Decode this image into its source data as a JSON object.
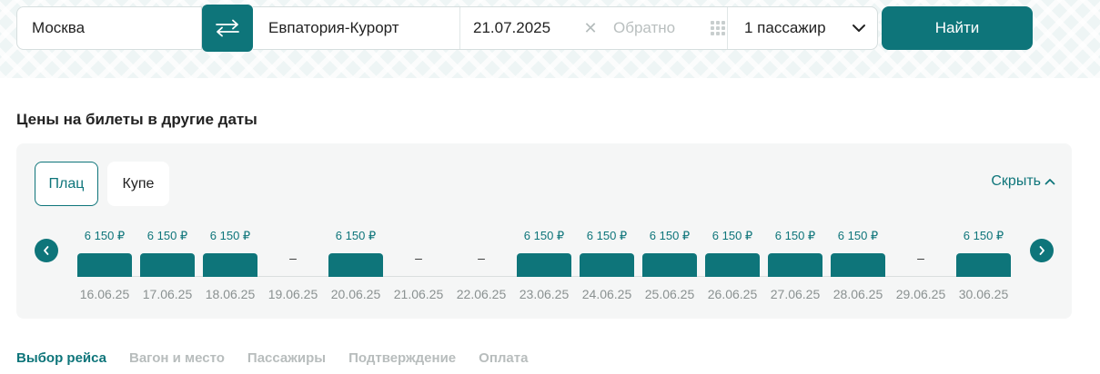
{
  "search": {
    "from": "Москва",
    "to": "Евпатория-Курорт",
    "date": "21.07.2025",
    "return_placeholder": "Обратно",
    "passengers": "1 пассажир",
    "submit_label": "Найти"
  },
  "prices": {
    "title": "Цены на билеты в другие даты",
    "tabs": [
      {
        "label": "Плац",
        "active": true
      },
      {
        "label": "Купе",
        "active": false
      }
    ],
    "hide_label": "Скрыть",
    "dash": "–",
    "days": [
      {
        "date": "16.06.25",
        "price": "6 150 ₽",
        "available": true
      },
      {
        "date": "17.06.25",
        "price": "6 150 ₽",
        "available": true
      },
      {
        "date": "18.06.25",
        "price": "6 150 ₽",
        "available": true
      },
      {
        "date": "19.06.25",
        "price": "",
        "available": false
      },
      {
        "date": "20.06.25",
        "price": "6 150 ₽",
        "available": true
      },
      {
        "date": "21.06.25",
        "price": "",
        "available": false
      },
      {
        "date": "22.06.25",
        "price": "",
        "available": false
      },
      {
        "date": "23.06.25",
        "price": "6 150 ₽",
        "available": true
      },
      {
        "date": "24.06.25",
        "price": "6 150 ₽",
        "available": true
      },
      {
        "date": "25.06.25",
        "price": "6 150 ₽",
        "available": true
      },
      {
        "date": "26.06.25",
        "price": "6 150 ₽",
        "available": true
      },
      {
        "date": "27.06.25",
        "price": "6 150 ₽",
        "available": true
      },
      {
        "date": "28.06.25",
        "price": "6 150 ₽",
        "available": true
      },
      {
        "date": "29.06.25",
        "price": "",
        "available": false
      },
      {
        "date": "30.06.25",
        "price": "6 150 ₽",
        "available": true
      }
    ]
  },
  "steps": [
    {
      "label": "Выбор рейса",
      "active": true
    },
    {
      "label": "Вагон и место",
      "active": false
    },
    {
      "label": "Пассажиры",
      "active": false
    },
    {
      "label": "Подтверждение",
      "active": false
    },
    {
      "label": "Оплата",
      "active": false
    }
  ],
  "colors": {
    "accent": "#0e757a",
    "muted": "#b8bdbd"
  },
  "icons": {
    "swap": "swap-arrows-icon",
    "clear": "close-icon",
    "calendar": "grid-dots-icon",
    "dropdown": "chevron-down-icon",
    "hide": "chevron-up-icon",
    "prev": "chevron-left-icon",
    "next": "chevron-right-icon"
  }
}
